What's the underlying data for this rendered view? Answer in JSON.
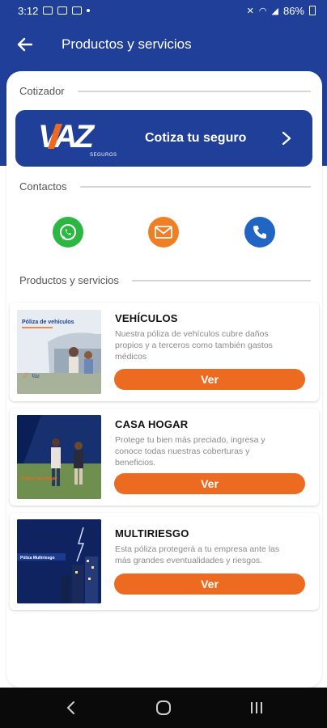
{
  "status_bar": {
    "time": "3:12",
    "battery": "86%"
  },
  "app_bar": {
    "title": "Productos y servicios",
    "back_icon": "arrow-left-icon"
  },
  "cotizador": {
    "section_label": "Cotizador",
    "logo_text": "VAZ",
    "logo_subtext": "SEGUROS",
    "button_label": "Cotiza tu seguro",
    "button_color": "#1f3f98"
  },
  "contacts": {
    "section_label": "Contactos",
    "items": [
      {
        "icon": "whatsapp-icon",
        "color": "#2bb741"
      },
      {
        "icon": "email-icon",
        "color": "#f07f23"
      },
      {
        "icon": "phone-icon",
        "color": "#2165c4"
      }
    ]
  },
  "products": {
    "section_label": "Productos y servicios",
    "items": [
      {
        "title": "VEHÍCULOS",
        "description": "Nuestra póliza de vehículos cubre daños propios y a terceros como también gastos médicos",
        "image_caption": "Póliza de vehículos",
        "button_label": "Ver"
      },
      {
        "title": "CASA HOGAR",
        "description": "Protege tu bien más preciado, ingresa y conoce todas nuestras coberturas y beneficios.",
        "image_caption": "Póliza Casa Hogar",
        "button_label": "Ver"
      },
      {
        "title": "MULTIRIESGO",
        "description": "Esta póliza protegerá a tu empresa ante las más grandes eventualidades y riesgos.",
        "image_caption": "Póliza Multiriesgo",
        "button_label": "Ver"
      }
    ],
    "button_color": "#ec6b21"
  },
  "nav_bar": {
    "back": "nav-back-icon",
    "home": "nav-home-icon",
    "recents": "nav-recents-icon"
  }
}
